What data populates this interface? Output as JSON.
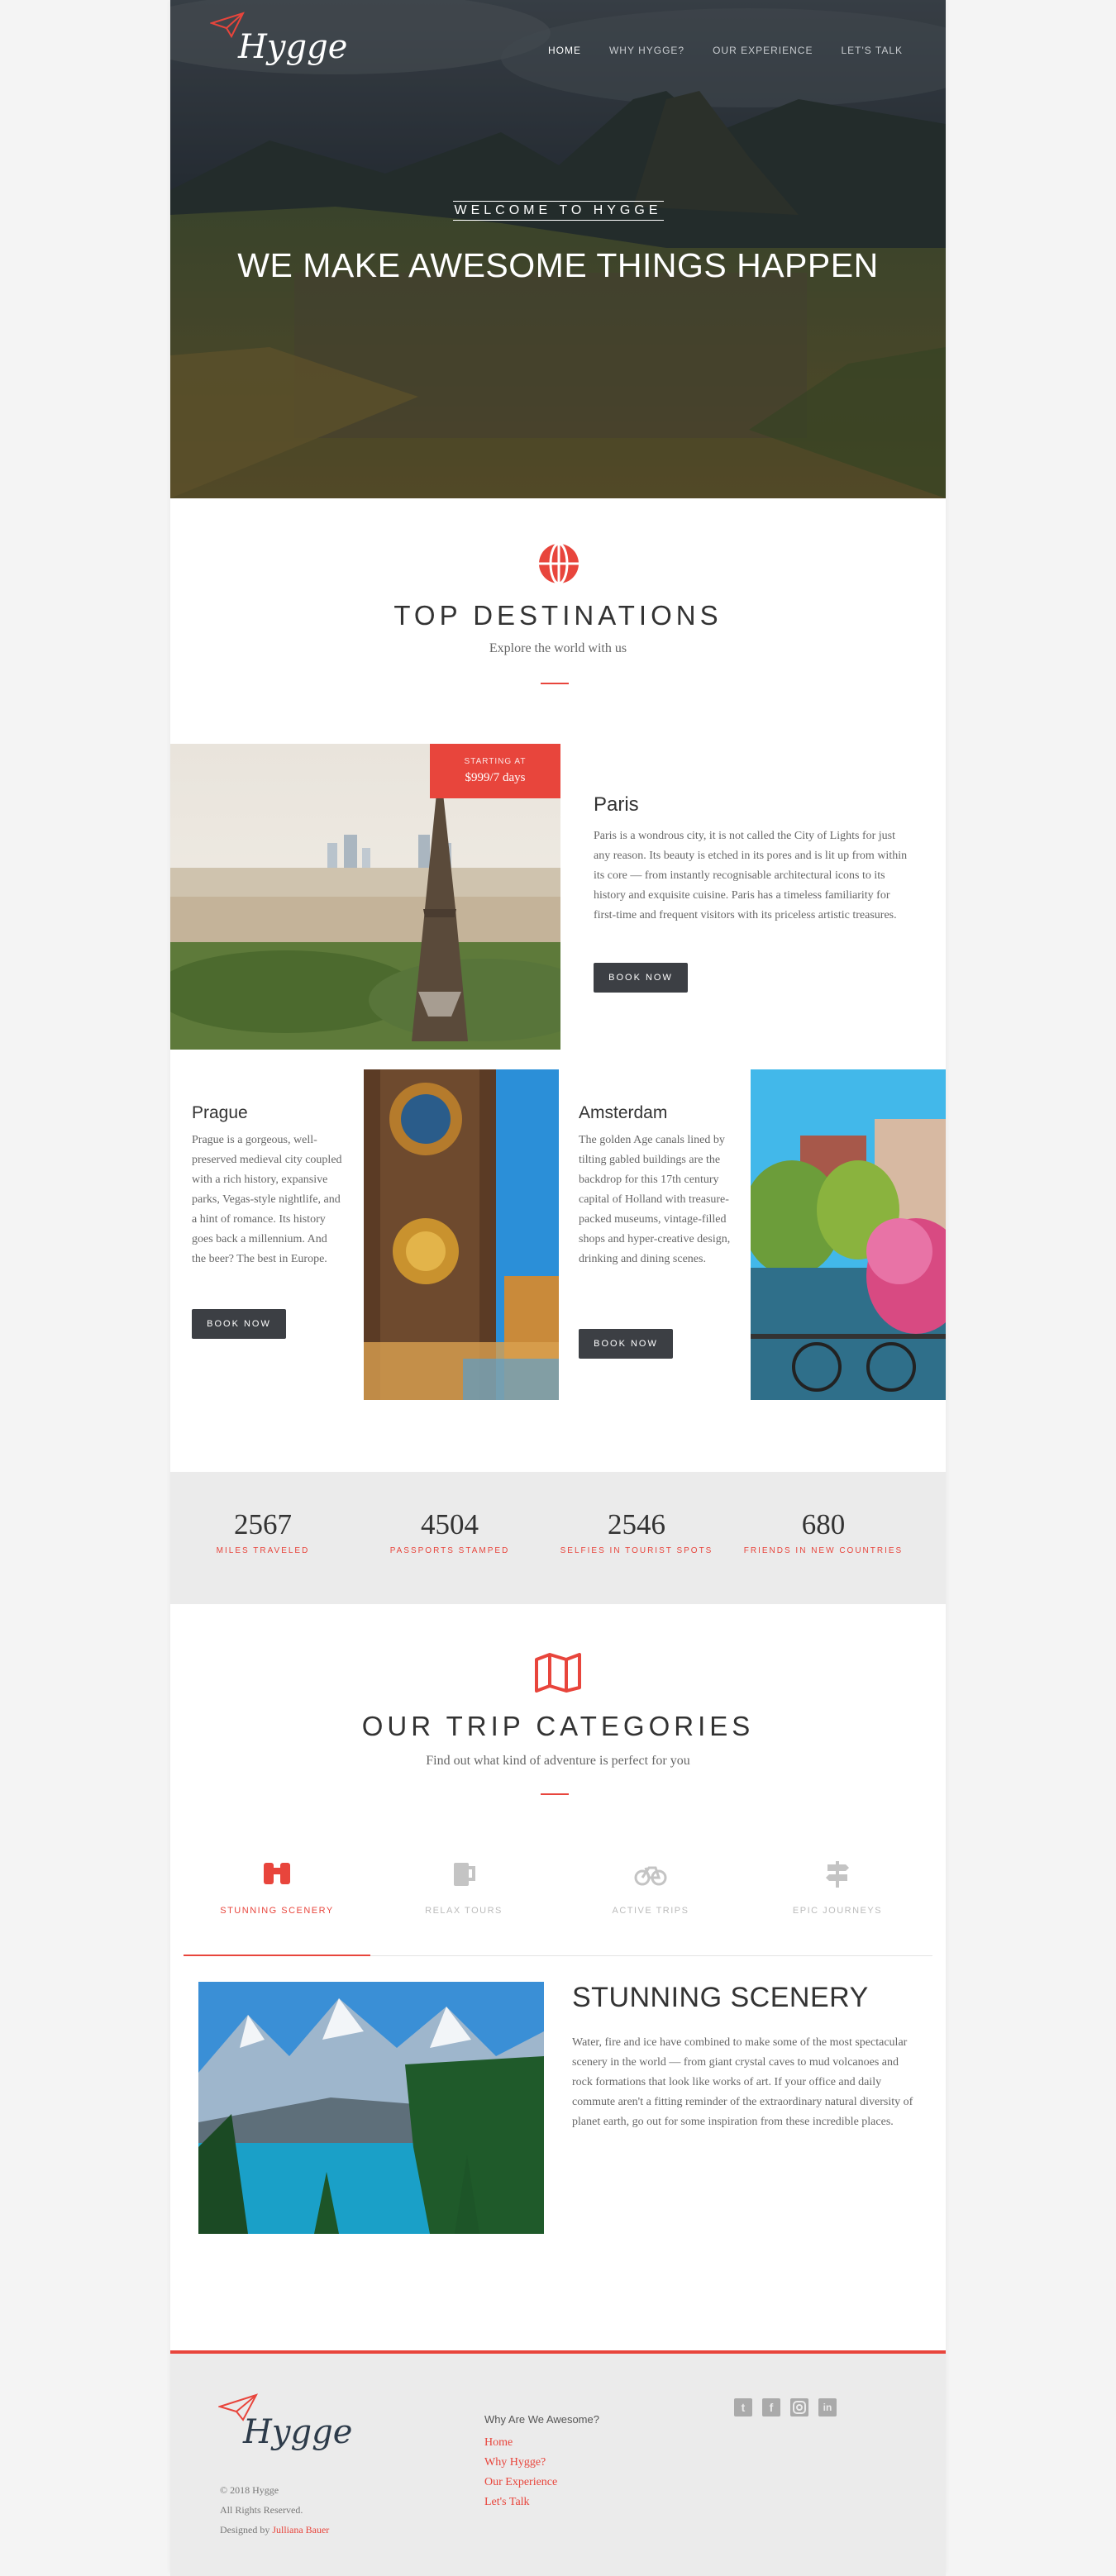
{
  "brand": {
    "name": "Hygge",
    "accent": "#e8453c",
    "dark_button": "#3c3f44"
  },
  "nav": [
    {
      "label": "HOME"
    },
    {
      "label": "WHY HYGGE?"
    },
    {
      "label": "OUR EXPERIENCE"
    },
    {
      "label": "LET'S TALK"
    }
  ],
  "hero": {
    "kicker": "WELCOME TO HYGGE",
    "title": "WE MAKE AWESOME THINGS HAPPEN"
  },
  "destinations": {
    "icon": "globe-icon",
    "title": "TOP DESTINATIONS",
    "subtitle": "Explore the world with us",
    "paris": {
      "badge_top": "STARTING AT",
      "badge_price": "$999/7 days",
      "name": "Paris",
      "text": "Paris is a wondrous city, it is not called the City of Lights for just any reason. Its beauty is etched in its pores and is lit up from within its core — from instantly recognisable architectural icons to its history and exquisite cuisine. Paris has a timeless familiarity for first-time and frequent visitors with its priceless artistic treasures.",
      "button": "BOOK NOW"
    },
    "prague": {
      "name": "Prague",
      "text": "Prague is a gorgeous, well-preserved medieval city coupled with a rich history, expansive parks, Vegas-style nightlife, and a hint of romance. Its history goes back a millennium. And the beer? The best in Europe.",
      "button": "BOOK NOW"
    },
    "amsterdam": {
      "name": "Amsterdam",
      "text": "The golden Age canals lined by tilting gabled buildings are the backdrop for this 17th century capital of Holland with treasure-packed museums, vintage-filled shops and hyper-creative design, drinking and dining scenes.",
      "button": "BOOK NOW"
    }
  },
  "stats": [
    {
      "value": "2567",
      "label": "MILES TRAVELED"
    },
    {
      "value": "4504",
      "label": "PASSPORTS STAMPED"
    },
    {
      "value": "2546",
      "label": "SELFIES IN TOURIST SPOTS"
    },
    {
      "value": "680",
      "label": "FRIENDS IN NEW COUNTRIES"
    }
  ],
  "categories": {
    "icon": "map-icon",
    "title": "OUR TRIP CATEGORIES",
    "subtitle": "Find out what kind of adventure is perfect for you",
    "tabs": [
      {
        "label": "STUNNING SCENERY",
        "icon": "binoculars-icon",
        "active": true
      },
      {
        "label": "RELAX TOURS",
        "icon": "beer-mug-icon",
        "active": false
      },
      {
        "label": "ACTIVE TRIPS",
        "icon": "bicycle-icon",
        "active": false
      },
      {
        "label": "EPIC JOURNEYS",
        "icon": "signpost-icon",
        "active": false
      }
    ],
    "panel_title": "STUNNING SCENERY",
    "panel_text": "Water, fire and ice have combined to make some of the most spectacular scenery in the world — from giant crystal caves to mud volcanoes and rock formations that look like works of art. If your office and daily commute aren't a fitting reminder of the extraordinary natural diversity of planet earth, go out for some inspiration from these incredible places."
  },
  "footer": {
    "copyright": "© 2018 Hygge",
    "rights": "All Rights Reserved.",
    "designed_by": "Designed by",
    "designer": "Julliana Bauer",
    "heading": "Why Are We Awesome?",
    "links": [
      {
        "label": "Home"
      },
      {
        "label": "Why Hygge?"
      },
      {
        "label": "Our Experience"
      },
      {
        "label": "Let's Talk"
      }
    ],
    "social": [
      "twitter-icon",
      "facebook-icon",
      "instagram-icon",
      "linkedin-icon"
    ]
  }
}
